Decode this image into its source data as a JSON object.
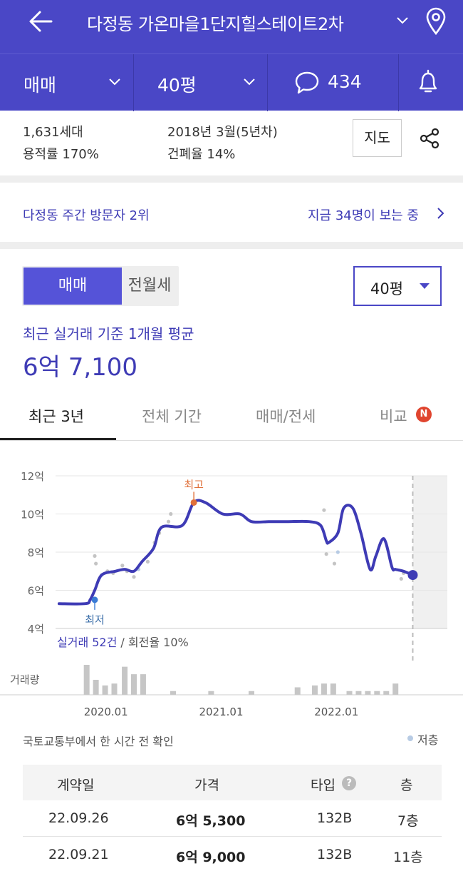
{
  "header": {
    "title": "다정동 가온마을1단지힐스테이트2차"
  },
  "subbar": {
    "deal_type": "매매",
    "size": "40평",
    "comment_count": "434"
  },
  "info": {
    "households": "1,631세대",
    "floor_area_ratio": "용적률 170%",
    "built": "2018년 3월(5년차)",
    "coverage_ratio": "건폐율 14%",
    "map_button": "지도"
  },
  "visitors": {
    "rank": "다정동 주간 방문자 2위",
    "watching": "지금 34명이 보는 중"
  },
  "price_panel": {
    "toggle": [
      "매매",
      "전월세"
    ],
    "size_select": "40평",
    "avg_caption": "최근 실거래 기준 1개월 평균",
    "avg_value": "6억 7,100"
  },
  "tabs": [
    {
      "label": "최근 3년",
      "active": true
    },
    {
      "label": "전체 기간",
      "active": false
    },
    {
      "label": "매매/전세",
      "active": false
    },
    {
      "label": "비교",
      "active": false,
      "badge": "N"
    }
  ],
  "chart_data": {
    "type": "line",
    "y_ticks": [
      "12억",
      "10억",
      "8억",
      "6억",
      "4억"
    ],
    "ylim": [
      4,
      12
    ],
    "x_ticks": [
      {
        "label": "2020.01",
        "x": 2020.0
      },
      {
        "label": "2021.01",
        "x": 2021.0
      },
      {
        "label": "2022.01",
        "x": 2022.0
      }
    ],
    "xlim": [
      2019.6,
      2023.0
    ],
    "series": [
      {
        "x": [
          2019.63,
          2019.86,
          2019.9,
          2019.94,
          2020.0,
          2020.12,
          2020.2,
          2020.28,
          2020.35,
          2020.45,
          2020.52,
          2020.7,
          2020.8,
          2020.9,
          2021.05,
          2021.2,
          2021.3,
          2021.45,
          2021.55,
          2021.62,
          2021.8,
          2021.9,
          2021.95,
          2021.97,
          2022.05,
          2022.1,
          2022.18,
          2022.25,
          2022.33,
          2022.38,
          2022.45,
          2022.52,
          2022.55,
          2022.62,
          2022.7
        ],
        "values": [
          5.3,
          5.3,
          5.5,
          6.0,
          6.8,
          7.0,
          7.1,
          7.0,
          7.5,
          8.2,
          9.3,
          9.4,
          10.6,
          10.6,
          10.0,
          10.0,
          9.6,
          9.6,
          9.6,
          9.6,
          9.6,
          9.4,
          8.6,
          8.5,
          9.0,
          10.3,
          10.3,
          9.0,
          7.1,
          7.8,
          8.7,
          7.2,
          7.1,
          7.0,
          6.8
        ]
      }
    ],
    "scatter": {
      "x": [
        2019.94,
        2019.95,
        2020.0,
        2020.05,
        2020.1,
        2020.18,
        2020.22,
        2020.28,
        2020.32,
        2020.4,
        2020.46,
        2020.5,
        2020.58,
        2020.6,
        2021.93,
        2021.95,
        2022.02,
        2022.05,
        2022.6,
        2022.62
      ],
      "values": [
        7.8,
        7.4,
        6.8,
        7.0,
        6.9,
        7.3,
        7.0,
        6.7,
        7.1,
        7.5,
        8.5,
        9.0,
        9.6,
        10.0,
        10.2,
        7.9,
        7.4,
        8.0,
        6.6,
        6.9
      ],
      "low_floor": [
        false,
        false,
        true,
        false,
        false,
        false,
        false,
        false,
        true,
        false,
        false,
        false,
        false,
        false,
        false,
        false,
        false,
        true,
        false,
        false
      ]
    },
    "high_point": {
      "label": "최고",
      "x": 2020.8,
      "value": 10.6
    },
    "low_point": {
      "label": "최저",
      "x": 2019.94,
      "value": 5.5
    },
    "current_point": {
      "x": 2022.7,
      "value": 6.8
    },
    "summary_count": "실거래 52건",
    "summary_turnover": "회전율 10%",
    "volume_label": "거래량",
    "volume": {
      "x": [
        2019.87,
        2019.95,
        2020.03,
        2020.11,
        2020.2,
        2020.28,
        2020.36,
        2020.62,
        2020.95,
        2021.3,
        2021.7,
        2021.85,
        2021.93,
        2022.01,
        2022.15,
        2022.23,
        2022.31,
        2022.39,
        2022.47,
        2022.55
      ],
      "values": [
        8,
        4,
        2.5,
        3,
        7.5,
        5.5,
        5.5,
        1,
        1,
        1,
        2,
        2.5,
        3,
        3,
        1,
        1,
        1,
        1,
        1,
        3
      ]
    },
    "legend": "저층"
  },
  "source_note": "국토교통부에서 한 시간 전 확인",
  "table": {
    "headers": [
      "계약일",
      "가격",
      "타입",
      "층"
    ],
    "help_icon": "?",
    "rows": [
      {
        "date": "22.09.26",
        "price": "6억 5,300",
        "type": "132B",
        "floor": "7층"
      },
      {
        "date": "22.09.21",
        "price": "6억 9,000",
        "type": "132B",
        "floor": "11층"
      }
    ]
  },
  "colors": {
    "brand": "#4a47c6",
    "line": "#3e3bb5",
    "high": "#e0703a",
    "low": "#3a7bd5",
    "badge": "#e0452f"
  }
}
